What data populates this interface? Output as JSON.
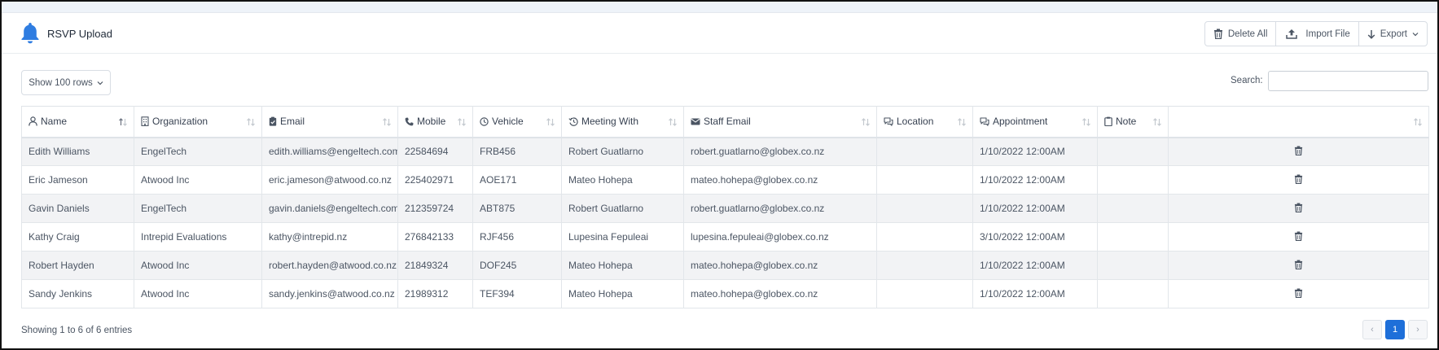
{
  "header": {
    "title": "RSVP Upload",
    "icon": "bell-icon",
    "accent_color": "#2f7de1"
  },
  "toolbar": {
    "delete_all_label": "Delete All",
    "import_file_label": "Import File",
    "export_label": "Export"
  },
  "controls": {
    "show_rows_label": "Show 100 rows",
    "search_label": "Search:",
    "search_value": ""
  },
  "table": {
    "columns": [
      {
        "label": "Name",
        "icon": "user-icon"
      },
      {
        "label": "Organization",
        "icon": "building-icon"
      },
      {
        "label": "Email",
        "icon": "clipboard-check-icon"
      },
      {
        "label": "Mobile",
        "icon": "phone-icon"
      },
      {
        "label": "Vehicle",
        "icon": "clock-icon"
      },
      {
        "label": "Meeting With",
        "icon": "history-icon"
      },
      {
        "label": "Staff Email",
        "icon": "envelope-icon"
      },
      {
        "label": "Location",
        "icon": "chat-icon"
      },
      {
        "label": "Appointment",
        "icon": "chat-icon"
      },
      {
        "label": "Note",
        "icon": "clipboard-icon"
      },
      {
        "label": "",
        "icon": ""
      }
    ],
    "rows": [
      {
        "name": "Edith Williams",
        "organization": "EngelTech",
        "email": "edith.williams@engeltech.com",
        "mobile": "22584694",
        "vehicle": "FRB456",
        "meeting_with": "Robert Guatlarno",
        "staff_email": "robert.guatlarno@globex.co.nz",
        "location": "",
        "appointment": "1/10/2022 12:00AM",
        "note": ""
      },
      {
        "name": "Eric Jameson",
        "organization": "Atwood Inc",
        "email": "eric.jameson@atwood.co.nz",
        "mobile": "225402971",
        "vehicle": "AOE171",
        "meeting_with": "Mateo Hohepa",
        "staff_email": "mateo.hohepa@globex.co.nz",
        "location": "",
        "appointment": "1/10/2022 12:00AM",
        "note": ""
      },
      {
        "name": "Gavin Daniels",
        "organization": "EngelTech",
        "email": "gavin.daniels@engeltech.com",
        "mobile": "212359724",
        "vehicle": "ABT875",
        "meeting_with": "Robert Guatlarno",
        "staff_email": "robert.guatlarno@globex.co.nz",
        "location": "",
        "appointment": "1/10/2022 12:00AM",
        "note": ""
      },
      {
        "name": "Kathy Craig",
        "organization": "Intrepid Evaluations",
        "email": "kathy@intrepid.nz",
        "mobile": "276842133",
        "vehicle": "RJF456",
        "meeting_with": "Lupesina Fepuleai",
        "staff_email": "lupesina.fepuleai@globex.co.nz",
        "location": "",
        "appointment": "3/10/2022 12:00AM",
        "note": ""
      },
      {
        "name": "Robert Hayden",
        "organization": "Atwood Inc",
        "email": "robert.hayden@atwood.co.nz",
        "mobile": "21849324",
        "vehicle": "DOF245",
        "meeting_with": "Mateo Hohepa",
        "staff_email": "mateo.hohepa@globex.co.nz",
        "location": "",
        "appointment": "1/10/2022 12:00AM",
        "note": ""
      },
      {
        "name": "Sandy Jenkins",
        "organization": "Atwood Inc",
        "email": "sandy.jenkins@atwood.co.nz",
        "mobile": "21989312",
        "vehicle": "TEF394",
        "meeting_with": "Mateo Hohepa",
        "staff_email": "mateo.hohepa@globex.co.nz",
        "location": "",
        "appointment": "1/10/2022 12:00AM",
        "note": ""
      }
    ]
  },
  "footer": {
    "info": "Showing 1 to 6 of 6 entries",
    "current_page": "1",
    "prev_label": "‹",
    "next_label": "›",
    "active_color": "#1e6fd9"
  }
}
